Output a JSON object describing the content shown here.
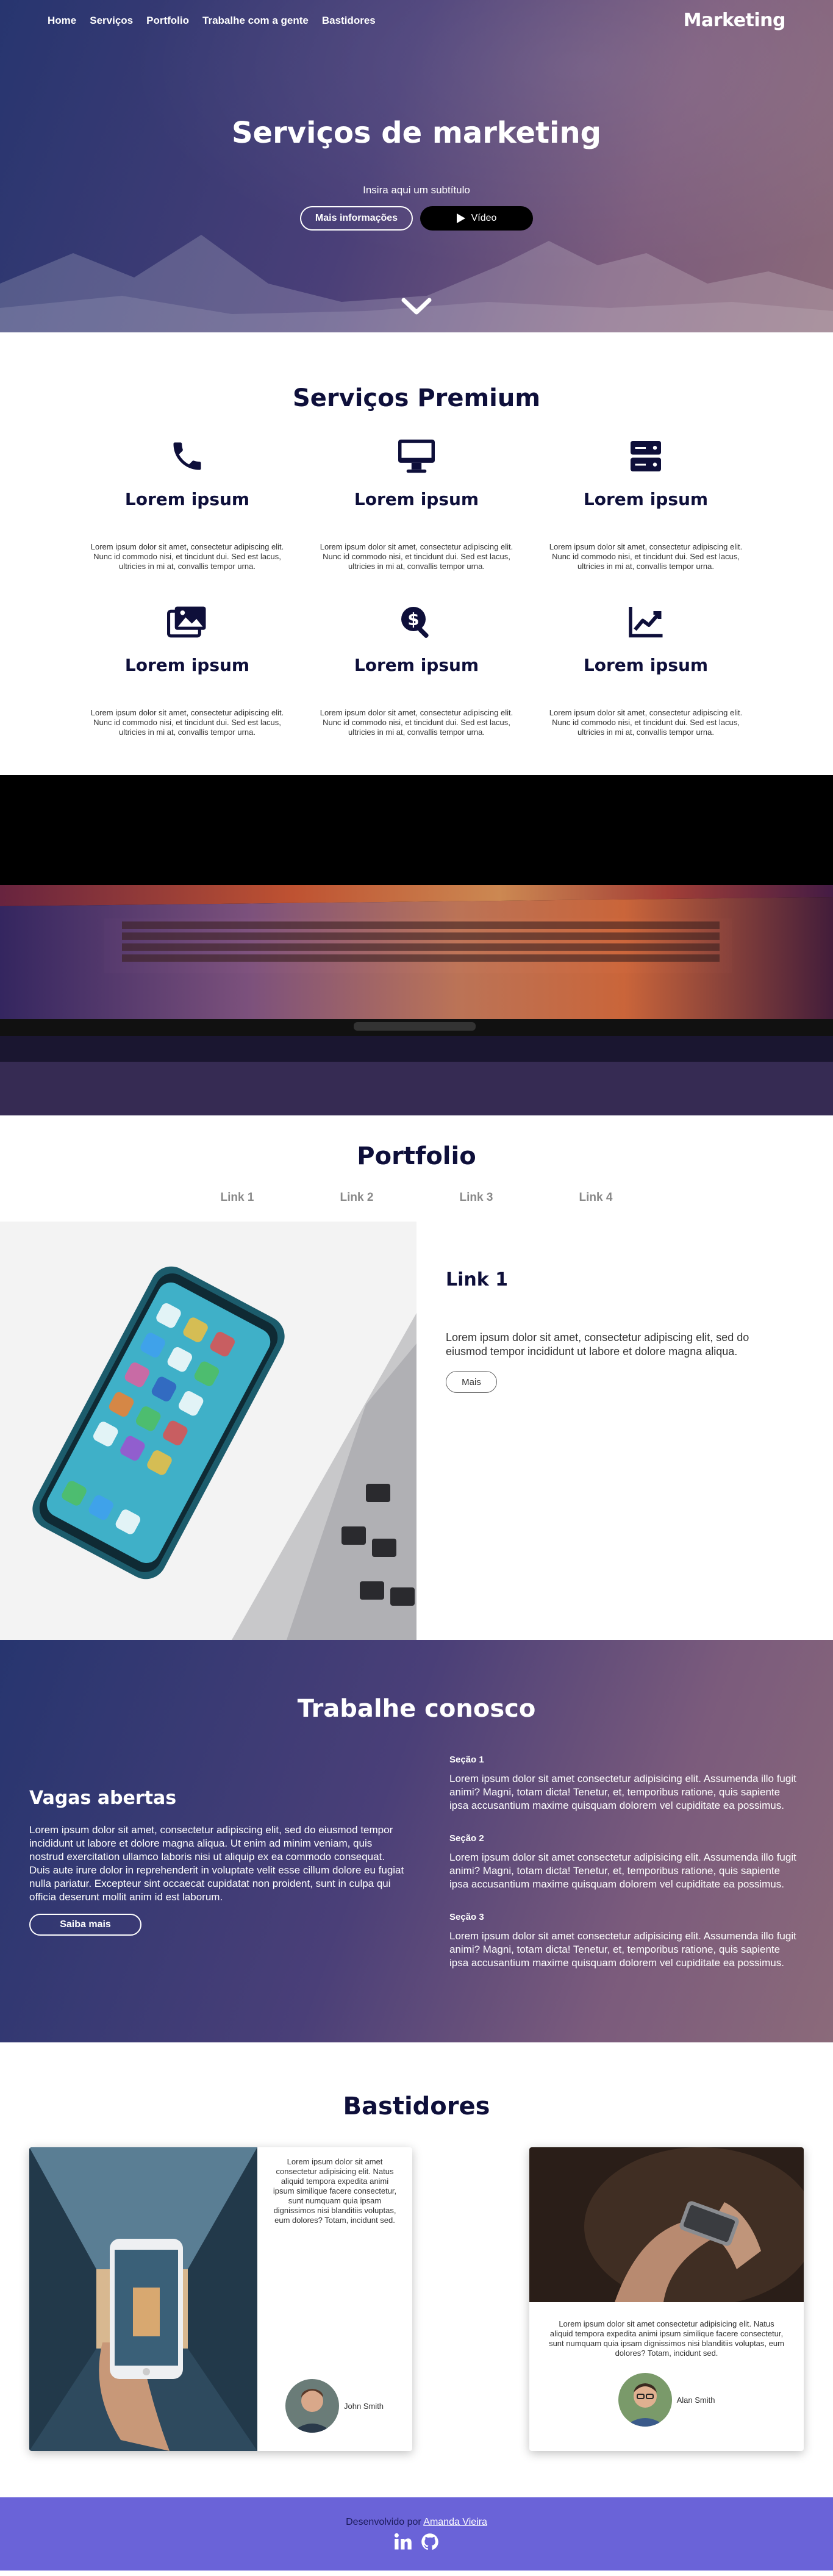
{
  "nav": {
    "items": [
      "Home",
      "Serviços",
      "Portfolio",
      "Trabalhe com a gente",
      "Bastidores"
    ],
    "brand": "Marketing"
  },
  "hero": {
    "title": "Serviços de marketing",
    "subtitle": "Insira aqui um subtítulo",
    "more_button": "Mais informações",
    "video_button": "Vídeo"
  },
  "services": {
    "title": "Serviços Premium",
    "items": [
      {
        "icon": "phone-icon",
        "title": "Lorem ipsum",
        "text": "Lorem ipsum dolor sit amet, consectetur adipiscing elit. Nunc id commodo nisi, et tincidunt dui. Sed est lacus, ultricies in mi at, convallis tempor urna."
      },
      {
        "icon": "desktop-icon",
        "title": "Lorem ipsum",
        "text": "Lorem ipsum dolor sit amet, consectetur adipiscing elit. Nunc id commodo nisi, et tincidunt dui. Sed est lacus, ultricies in mi at, convallis tempor urna."
      },
      {
        "icon": "server-icon",
        "title": "Lorem ipsum",
        "text": "Lorem ipsum dolor sit amet, consectetur adipiscing elit. Nunc id commodo nisi, et tincidunt dui. Sed est lacus, ultricies in mi at, convallis tempor urna."
      },
      {
        "icon": "images-icon",
        "title": "Lorem ipsum",
        "text": "Lorem ipsum dolor sit amet, consectetur adipiscing elit. Nunc id commodo nisi, et tincidunt dui. Sed est lacus, ultricies in mi at, convallis tempor urna."
      },
      {
        "icon": "search-dollar-icon",
        "title": "Lorem ipsum",
        "text": "Lorem ipsum dolor sit amet, consectetur adipiscing elit. Nunc id commodo nisi, et tincidunt dui. Sed est lacus, ultricies in mi at, convallis tempor urna."
      },
      {
        "icon": "chart-line-icon",
        "title": "Lorem ipsum",
        "text": "Lorem ipsum dolor sit amet, consectetur adipiscing elit. Nunc id commodo nisi, et tincidunt dui. Sed est lacus, ultricies in mi at, convallis tempor urna."
      }
    ]
  },
  "portfolio": {
    "title": "Portfolio",
    "links": [
      "Link 1",
      "Link 2",
      "Link 3",
      "Link 4"
    ],
    "active": {
      "title": "Link 1",
      "text": "Lorem ipsum dolor sit amet, consectetur adipiscing elit, sed do eiusmod tempor incididunt ut labore et dolore magna aliqua.",
      "button": "Mais"
    }
  },
  "work": {
    "title": "Trabalhe conosco",
    "left": {
      "heading": "Vagas abertas",
      "text": "Lorem ipsum dolor sit amet, consectetur adipiscing elit, sed do eiusmod tempor incididunt ut labore et dolore magna aliqua. Ut enim ad minim veniam, quis nostrud exercitation ullamco laboris nisi ut aliquip ex ea commodo consequat. Duis aute irure dolor in reprehenderit in voluptate velit esse cillum dolore eu fugiat nulla pariatur. Excepteur sint occaecat cupidatat non proident, sunt in culpa qui officia deserunt mollit anim id est laborum.",
      "button": "Saiba mais"
    },
    "sections": [
      {
        "title": "Seção 1",
        "text": "Lorem ipsum dolor sit amet consectetur adipisicing elit. Assumenda illo fugit animi? Magni, totam dicta! Tenetur, et, temporibus ratione, quis sapiente ipsa accusantium maxime quisquam dolorem vel cupiditate ea possimus."
      },
      {
        "title": "Seção 2",
        "text": "Lorem ipsum dolor sit amet consectetur adipisicing elit. Assumenda illo fugit animi? Magni, totam dicta! Tenetur, et, temporibus ratione, quis sapiente ipsa accusantium maxime quisquam dolorem vel cupiditate ea possimus."
      },
      {
        "title": "Seção 3",
        "text": "Lorem ipsum dolor sit amet consectetur adipisicing elit. Assumenda illo fugit animi? Magni, totam dicta! Tenetur, et, temporibus ratione, quis sapiente ipsa accusantium maxime quisquam dolorem vel cupiditate ea possimus."
      }
    ]
  },
  "behind": {
    "title": "Bastidores",
    "cards": [
      {
        "text": "Lorem ipsum dolor sit amet consectetur adipisicing elit. Natus aliquid tempora expedita animi ipsum similique facere consectetur, sunt numquam quia ipsam dignissimos nisi blanditiis voluptas, eum dolores? Totam, incidunt sed.",
        "person": "John Smith"
      },
      {
        "text": "Lorem ipsum dolor sit amet consectetur adipisicing elit. Natus aliquid tempora expedita animi ipsum similique facere consectetur, sunt numquam quia ipsam dignissimos nisi blanditiis voluptas, eum dolores? Totam, incidunt sed.",
        "person": "Alan Smith"
      }
    ]
  },
  "footer": {
    "credit_prefix": "Desenvolvido por",
    "author": "Amanda Vieira",
    "social": [
      "linkedin-icon",
      "github-icon"
    ]
  },
  "colors": {
    "navy": "#0e0f3a",
    "hero_start": "#27356f",
    "hero_end": "#8b6a7a",
    "footer": "#6a63d8"
  }
}
